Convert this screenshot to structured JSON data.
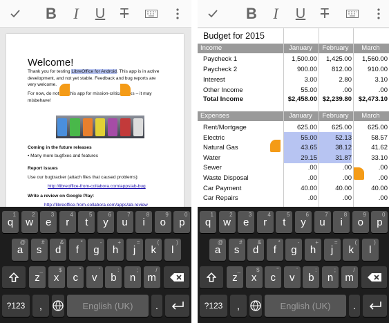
{
  "toolbar": {
    "check_icon": "check-icon",
    "bold_label": "B",
    "italic_label": "I",
    "underline_label": "U",
    "strike_label": "T"
  },
  "writer": {
    "title": "Welcome!",
    "p1_a": "Thank you for testing",
    "p1_sel": "LibreOffice for Android",
    "p1_b": ". This app is in active",
    "p1_line2": "development, and not yet stable. Feedback and bug reports are",
    "p1_line3": "very welcome.",
    "p2_line1": "For now, do not use this app for mission-critical tasks – it may",
    "p2_line2": "misbehave!",
    "section1": "Coming in the future releases",
    "bullet1": "•  Many more bugfixes and features",
    "section2": "Report issues",
    "report_text": "Use our bugtracker (attach files that caused problems):",
    "bug_link": "http://libreoffice-from-collabora.com/apps/ab-bug",
    "section3": "Write a review on Google Play:",
    "review_link": "http://libreoffice-from-collabora.com/apps/ab-review"
  },
  "calc": {
    "title": "Budget for 2015",
    "months": [
      "January",
      "February",
      "March"
    ],
    "income_label": "Income",
    "income_rows": [
      {
        "label": "Paycheck 1",
        "v": [
          "1,500.00",
          "1,425.00",
          "1,560.00"
        ]
      },
      {
        "label": "Paycheck 2",
        "v": [
          "900.00",
          "812.00",
          "910.00"
        ]
      },
      {
        "label": "Interest",
        "v": [
          "3.00",
          "2.80",
          "3.10"
        ]
      },
      {
        "label": "Other Income",
        "v": [
          "55.00",
          ".00",
          ".00"
        ]
      }
    ],
    "total_income": {
      "label": "Total Income",
      "v": [
        "$2,458.00",
        "$2,239.80",
        "$2,473.10"
      ]
    },
    "expenses_label": "Expenses",
    "expense_rows": [
      {
        "label": "Rent/Mortgage",
        "v": [
          "625.00",
          "625.00",
          "625.00"
        ]
      },
      {
        "label": "Electric",
        "v": [
          "55.00",
          "52.13",
          "58.57"
        ]
      },
      {
        "label": "Natural Gas",
        "v": [
          "43.65",
          "38.12",
          "41.62"
        ]
      },
      {
        "label": "Water",
        "v": [
          "29.15",
          "31.87",
          "33.10"
        ]
      },
      {
        "label": "Sewer",
        "v": [
          ".00",
          ".00",
          ".00"
        ]
      },
      {
        "label": "Waste Disposal",
        "v": [
          ".00",
          ".00",
          ".00"
        ]
      },
      {
        "label": "Car Payment",
        "v": [
          "40.00",
          "40.00",
          "40.00"
        ]
      },
      {
        "label": "Car Repairs",
        "v": [
          ".00",
          ".00",
          ".00"
        ]
      }
    ]
  },
  "keyboard": {
    "row1": [
      "q",
      "w",
      "e",
      "r",
      "t",
      "y",
      "u",
      "i",
      "o",
      "p"
    ],
    "row1_sup": [
      "1",
      "2",
      "3",
      "4",
      "5",
      "6",
      "7",
      "8",
      "9",
      "0"
    ],
    "row2": [
      "a",
      "s",
      "d",
      "f",
      "g",
      "h",
      "j",
      "k",
      "l"
    ],
    "row2_sup": [
      "@",
      "#",
      "&",
      "*",
      "-",
      "+",
      "=",
      "(",
      ")"
    ],
    "row3": [
      "z",
      "x",
      "c",
      "v",
      "b",
      "n",
      "m"
    ],
    "row3_sup": [
      "_",
      "$",
      "\"",
      "'",
      ":",
      ";",
      "/"
    ],
    "symbols_label": "?123",
    "comma": ",",
    "space_label": "English (UK)",
    "period": "."
  }
}
